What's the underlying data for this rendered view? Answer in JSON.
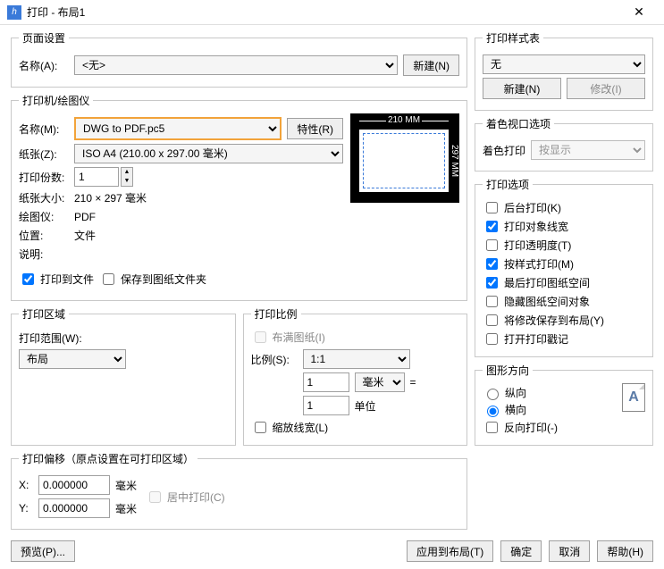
{
  "window": {
    "title": "打印 - 布局1"
  },
  "page_setup": {
    "legend": "页面设置",
    "name_label": "名称(A):",
    "name_value": "<无>",
    "new_btn": "新建(N)"
  },
  "printer": {
    "legend": "打印机/绘图仪",
    "name_label": "名称(M):",
    "name_value": "DWG to PDF.pc5",
    "props_btn": "特性(R)",
    "paper_label": "纸张(Z):",
    "paper_value": "ISO A4 (210.00 x 297.00 毫米)",
    "copies_label": "打印份数:",
    "copies_value": "1",
    "size_label": "纸张大小:",
    "size_value": "210 × 297  毫米",
    "plotter_label": "绘图仪:",
    "plotter_value": "PDF",
    "location_label": "位置:",
    "location_value": "文件",
    "desc_label": "说明:",
    "to_file_label": "打印到文件",
    "save_layout_label": "保存到图纸文件夹",
    "preview": {
      "w": "210 MM",
      "h": "297 MM"
    }
  },
  "area": {
    "legend": "打印区域",
    "range_label": "打印范围(W):",
    "range_value": "布局"
  },
  "scale": {
    "legend": "打印比例",
    "fit_label": "布满图纸(I)",
    "ratio_label": "比例(S):",
    "ratio_value": "1:1",
    "mm_value": "1",
    "mm_unit": "毫米",
    "eq": "=",
    "unit_value": "1",
    "unit_unit": "单位",
    "scale_lw_label": "缩放线宽(L)"
  },
  "offset": {
    "legend": "打印偏移（原点设置在可打印区域）",
    "x_label": "X:",
    "x_value": "0.000000",
    "y_label": "Y:",
    "y_value": "0.000000",
    "unit": "毫米",
    "center_label": "居中打印(C)"
  },
  "styles": {
    "legend": "打印样式表",
    "value": "无",
    "new_btn": "新建(N)",
    "edit_btn": "修改(I)"
  },
  "shaded": {
    "legend": "着色视口选项",
    "label": "着色打印",
    "value": "按显示"
  },
  "options": {
    "legend": "打印选项",
    "bg": "后台打印(K)",
    "lw": "打印对象线宽",
    "transp": "打印透明度(T)",
    "bystyle": "按样式打印(M)",
    "last": "最后打印图纸空间",
    "hide": "隐藏图纸空间对象",
    "savechg": "将修改保存到布局(Y)",
    "stamp": "打开打印戳记"
  },
  "orient": {
    "legend": "图形方向",
    "portrait": "纵向",
    "landscape": "横向",
    "reverse": "反向打印(-)",
    "glyph": "A"
  },
  "footer": {
    "preview": "预览(P)...",
    "apply": "应用到布局(T)",
    "ok": "确定",
    "cancel": "取消",
    "help": "帮助(H)"
  }
}
